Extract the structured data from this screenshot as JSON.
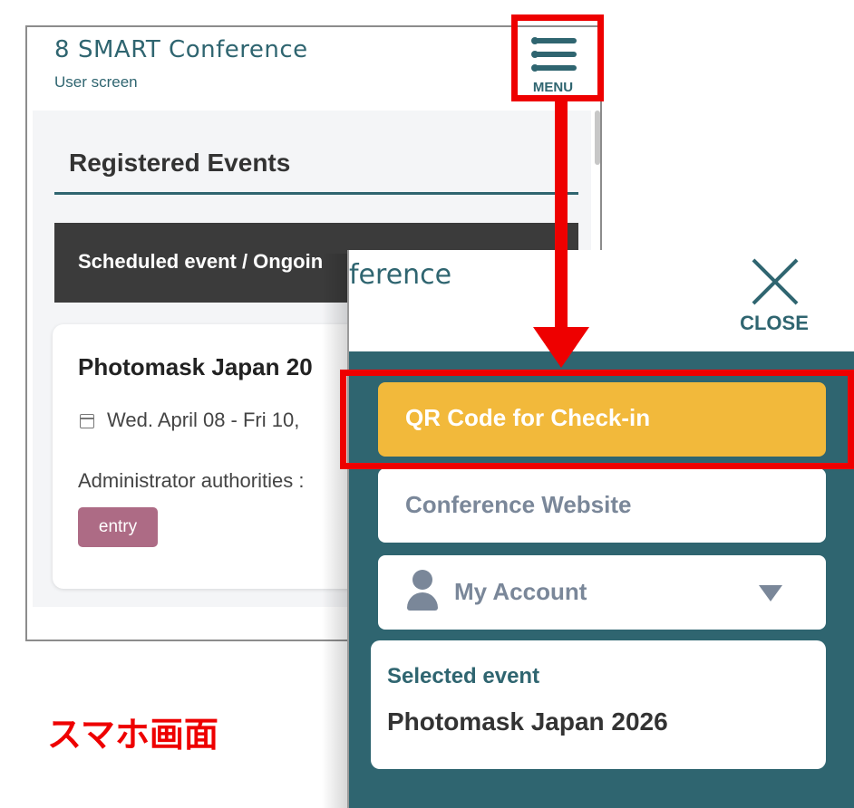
{
  "phone": {
    "logo_mark": "8",
    "app_title": "SMART Conference",
    "subtitle": "User screen",
    "menu_label": "MENU",
    "registered_title": "Registered Events",
    "schedule_bar": "Scheduled event / Ongoin",
    "event": {
      "name": "Photomask Japan 20",
      "date": "Wed. April 08 - Fri 10,",
      "admin": "Administrator authorities :",
      "badge": "entry"
    }
  },
  "menu_panel": {
    "title_partial": "ference",
    "close_label": "CLOSE",
    "items": [
      {
        "label": "QR Code for Check-in",
        "color": "#f2b93b"
      },
      {
        "label": "Conference Website"
      },
      {
        "label": "My Account"
      }
    ],
    "selected_event_label": "Selected event",
    "selected_event_value": "Photomask Japan 2026"
  },
  "annotation": {
    "caption": "スマホ画面",
    "color": "#ee0000"
  },
  "colors": {
    "primary": "#2f6570",
    "accent": "#f2b93b",
    "badge": "#ad6b85"
  },
  "icons": [
    "menu-icon",
    "calendar-icon",
    "close-icon",
    "user-icon",
    "dropdown-triangle-icon"
  ]
}
